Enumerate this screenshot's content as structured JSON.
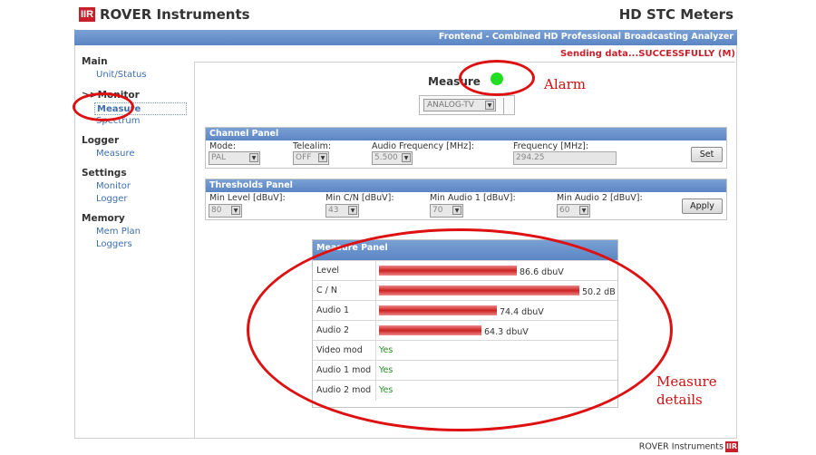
{
  "header": {
    "logo_text": "IIR",
    "brand": "ROVER Instruments",
    "product": "HD STC Meters",
    "subtitle": "Frontend - Combined HD Professional Broadcasting Analyzer",
    "status": "Sending data...SUCCESSFULLY (M)"
  },
  "sidebar": {
    "groups": [
      {
        "label": "Main",
        "items": [
          "Unit/Status"
        ]
      },
      {
        "label": ">>Monitor",
        "items": [
          "Measure",
          "Spectrum"
        ]
      },
      {
        "label": "Logger",
        "items": [
          "Measure"
        ]
      },
      {
        "label": "Settings",
        "items": [
          "Monitor",
          "Logger"
        ]
      },
      {
        "label": "Memory",
        "items": [
          "Mem Plan",
          "Loggers"
        ]
      }
    ]
  },
  "measure": {
    "title": "Measure",
    "alarm_color": "#22dd22",
    "mode_value": "ANALOG-TV"
  },
  "channel_panel": {
    "title": "Channel Panel",
    "mode_label": "Mode:",
    "mode_value": "PAL",
    "telealim_label": "Telealim:",
    "telealim_value": "OFF",
    "audio_freq_label": "Audio Frequency [MHz]:",
    "audio_freq_value": "5.500",
    "freq_label": "Frequency [MHz]:",
    "freq_value": "294.25",
    "set_button": "Set"
  },
  "thresholds_panel": {
    "title": "Thresholds Panel",
    "min_level_label": "Min Level [dBuV]:",
    "min_level_value": "80",
    "min_cn_label": "Min C/N [dBuV]:",
    "min_cn_value": "43",
    "min_audio1_label": "Min Audio 1 [dBuV]:",
    "min_audio1_value": "70",
    "min_audio2_label": "Min Audio 2 [dBuV]:",
    "min_audio2_value": "60",
    "apply_button": "Apply"
  },
  "measure_panel": {
    "title": "Measure Panel",
    "rows": [
      {
        "label": "Level",
        "value": "86.6 dbuV",
        "fill": 0.69
      },
      {
        "label": "C / N",
        "value": "50.2 dB",
        "fill": 1.0
      },
      {
        "label": "Audio 1",
        "value": "74.4 dbuV",
        "fill": 0.59
      },
      {
        "label": "Audio 2",
        "value": "64.3 dbuV",
        "fill": 0.51
      }
    ],
    "status_rows": [
      {
        "label": "Video mod",
        "value": "Yes"
      },
      {
        "label": "Audio 1 mod",
        "value": "Yes"
      },
      {
        "label": "Audio 2 mod",
        "value": "Yes"
      }
    ]
  },
  "annotations": {
    "alarm": "Alarm",
    "measure_details_1": "Measure",
    "measure_details_2": "details",
    "ring_color": "#dd1111"
  },
  "footer": {
    "text": "ROVER Instruments",
    "logo_text": "IIR"
  }
}
